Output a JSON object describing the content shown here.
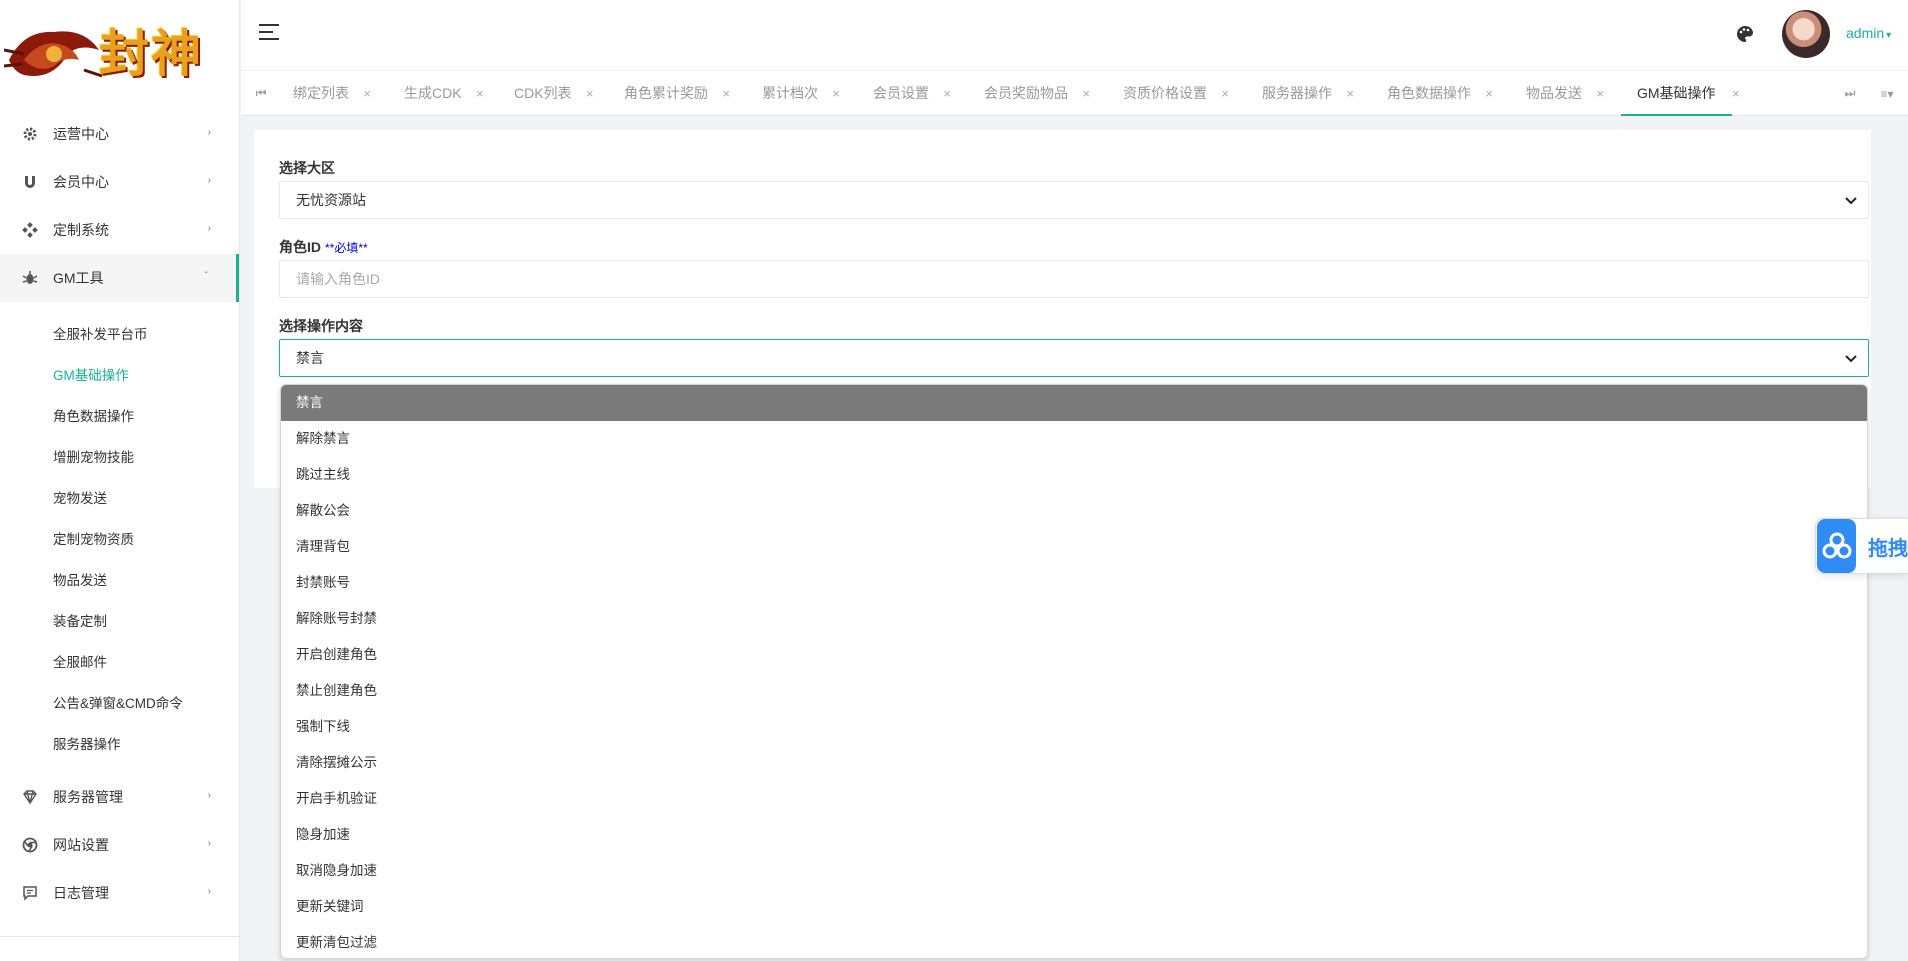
{
  "logo": {
    "text": "封神"
  },
  "sidebar": {
    "items": [
      {
        "label": "运营中心",
        "icon": "gear-icon"
      },
      {
        "label": "会员中心",
        "icon": "magnet-icon"
      },
      {
        "label": "定制系统",
        "icon": "diamond-grid-icon"
      },
      {
        "label": "GM工具",
        "icon": "bug-icon"
      },
      {
        "label": "服务器管理",
        "icon": "gem-icon"
      },
      {
        "label": "网站设置",
        "icon": "chrome-icon"
      },
      {
        "label": "日志管理",
        "icon": "comment-icon"
      }
    ],
    "gm_sub": [
      "全服补发平台币",
      "GM基础操作",
      "角色数据操作",
      "增删宠物技能",
      "宠物发送",
      "定制宠物资质",
      "物品发送",
      "装备定制",
      "全服邮件",
      "公告&弹窗&CMD命令",
      "服务器操作"
    ]
  },
  "header": {
    "username": "admin"
  },
  "tabs": [
    "绑定列表",
    "生成CDK",
    "CDK列表",
    "角色累计奖励",
    "累计档次",
    "会员设置",
    "会员奖励物品",
    "资质价格设置",
    "服务器操作",
    "角色数据操作",
    "物品发送",
    "GM基础操作"
  ],
  "form": {
    "region_label": "选择大区",
    "region_value": "无忧资源站",
    "role_label": "角色ID",
    "role_required": "**必填**",
    "role_placeholder": "请输入角色ID",
    "op_label": "选择操作内容",
    "op_value": "禁言"
  },
  "dropdown_options": [
    "禁言",
    "解除禁言",
    "跳过主线",
    "解散公会",
    "清理背包",
    "封禁账号",
    "解除账号封禁",
    "开启创建角色",
    "禁止创建角色",
    "强制下线",
    "清除摆摊公示",
    "开启手机验证",
    "隐身加速",
    "取消隐身加速",
    "更新关键词",
    "更新清包过滤"
  ],
  "float_widget": {
    "text": "拖拽"
  },
  "colors": {
    "accent": "#1ab394",
    "selected_option": "#7a7a7a",
    "widget_blue": "#2f8cf5"
  }
}
